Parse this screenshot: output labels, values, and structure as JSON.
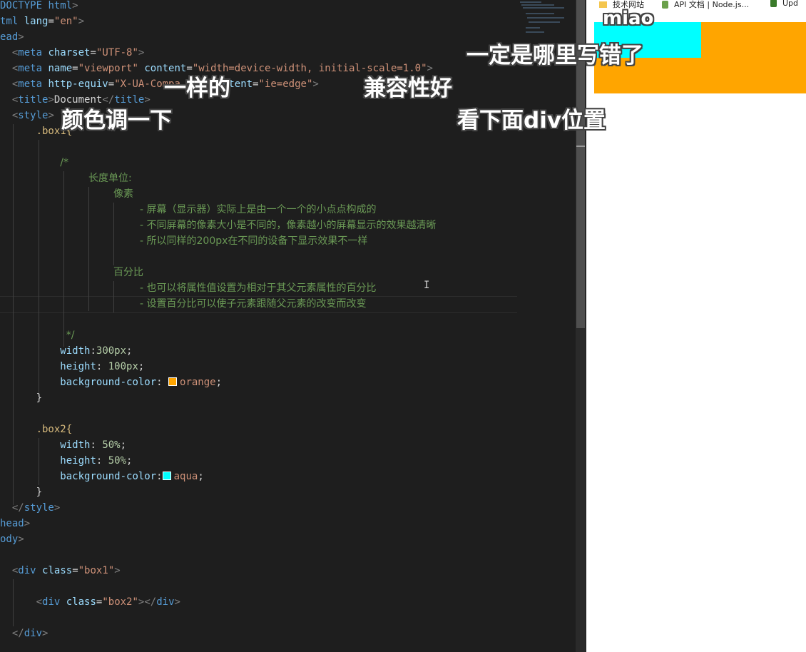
{
  "editor": {
    "code": {
      "l1_doctype": "DOCTYPE",
      "l1_html": "html",
      "l2_tml": "tml",
      "l2_attr": "lang",
      "l2_val": "\"en\"",
      "l3_ead": "ead",
      "meta": "meta",
      "charset_attr": "charset",
      "charset_val": "\"UTF-8\"",
      "name_attr": "name",
      "name_val": "\"viewport\"",
      "content_attr": "content",
      "content_val": "\"width=device-width, initial-scale=1.0\"",
      "httpequiv_attr": "http-equiv",
      "httpequiv_val": "\"X-UA-Compa",
      "content2_attr": "content",
      "content2_val": "\"ie=edge\"",
      "title_tag": "title",
      "title_text": "Document",
      "style_tag": "style",
      "box1_sel": ".box1{",
      "comment_open": "/*",
      "c_units": "长度单位:",
      "c_pixel": "像素",
      "c_p1": "- 屏幕（显示器）实际上是由一个一个的小点点构成的",
      "c_p2": "- 不同屏幕的像素大小是不同的，像素越小的屏幕显示的效果越清晰",
      "c_p3": "- 所以同样的200px在不同的设备下显示效果不一样",
      "c_percent": "百分比",
      "c_q1": "- 也可以将属性值设置为相对于其父元素属性的百分比",
      "c_q2": "- 设置百分比可以使子元素跟随父元素的改变而改变",
      "comment_close": "*/",
      "width_prop": "width",
      "width_val": "300px",
      "height_prop": "height",
      "height_val": "100px",
      "bg_prop": "background-color",
      "bg_val1": "orange",
      "close_brace": "}",
      "box2_sel": ".box2{",
      "width2_val": "50%",
      "height2_val": "50%",
      "bg_val2": "aqua",
      "head_text": "head",
      "body_text": "ody",
      "div_tag": "div",
      "class_attr": "class",
      "box1_cls": "\"box1\"",
      "box2_cls": "\"box2\""
    },
    "cursor_glyph": "I"
  },
  "browser": {
    "bookmarks": [
      {
        "label": "技术网站",
        "icon": "folder-icon"
      },
      {
        "label": "API 文档 | Node.js...",
        "icon": "nodejs-icon"
      },
      {
        "label": "Upd",
        "icon": "bookmark-icon"
      }
    ],
    "box1_color": "#ffa500",
    "box2_color": "#00ffff"
  },
  "subtitles": {
    "s1": "miao",
    "s2": "一定是哪里写错了",
    "s3": "一样的",
    "s4": "兼容性好",
    "s5": "颜色调一下",
    "s6": "看下面div位置"
  },
  "colors": {
    "editor_bg": "#1e1e1e",
    "tag_name": "#569cd6",
    "attribute": "#9cdcfe",
    "string": "#ce9178",
    "selector": "#d7ba7d",
    "number": "#b5cea8",
    "comment": "#6a9955"
  }
}
